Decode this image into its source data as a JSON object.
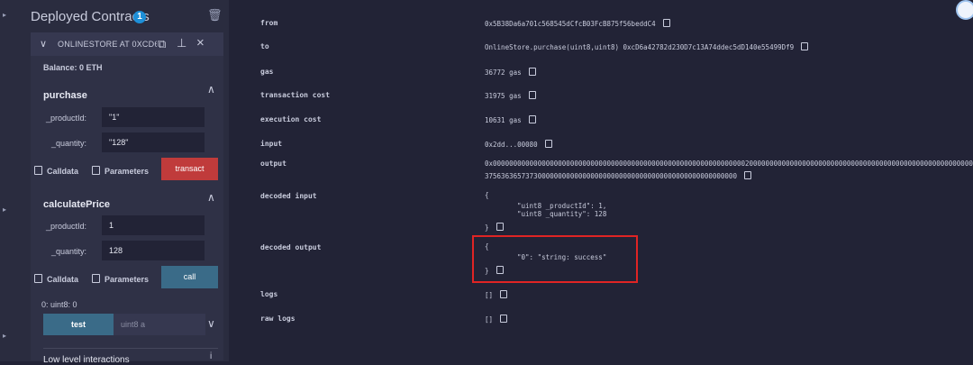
{
  "sidebar": {
    "title": "Deployed Contracts",
    "count": "1",
    "contract": {
      "name": "ONLINESTORE AT 0XCD6...99D",
      "balance": "Balance: 0 ETH",
      "functions": [
        {
          "name": "purchase",
          "params": [
            {
              "label": "_productId:",
              "value": "\"1\""
            },
            {
              "label": "_quantity:",
              "value": "\"128\""
            }
          ],
          "calldata": "Calldata",
          "parameters": "Parameters",
          "action": "transact"
        },
        {
          "name": "calculatePrice",
          "params": [
            {
              "label": "_productId:",
              "value": "1"
            },
            {
              "label": "_quantity:",
              "value": "128"
            }
          ],
          "calldata": "Calldata",
          "parameters": "Parameters",
          "action": "call",
          "result": "0: uint8: 0"
        }
      ],
      "test": {
        "label": "test",
        "placeholder": "uint8 a"
      }
    },
    "low_level": "Low level interactions"
  },
  "tx": {
    "from_label": "from",
    "from_value": "0x5B38Da6a701c568545dCfcB03FcB875f56beddC4",
    "to_label": "to",
    "to_value": "OnlineStore.purchase(uint8,uint8) 0xcD6a42782d230D7c13A74ddec5dD140e55499Df9",
    "gas_label": "gas",
    "gas_value": "36772 gas",
    "txcost_label": "transaction cost",
    "txcost_value": "31975 gas",
    "execcost_label": "execution cost",
    "execcost_value": "10631 gas",
    "input_label": "input",
    "input_value": "0x2dd...00080",
    "output_label": "output",
    "output_line1": "0x000000000000000000000000000000000000000000000000000000000000002000000000000000000000000000000000000000000000000000000000000000",
    "output_line2": "37563636573730000000000000000000000000000000000000000000000000",
    "decoded_input_label": "decoded input",
    "decoded_input_open": "{",
    "decoded_input_line1": "\"uint8 _productId\": 1,",
    "decoded_input_line2": "\"uint8 _quantity\": 128",
    "decoded_input_close": "}",
    "decoded_output_label": "decoded output",
    "decoded_output_open": "{",
    "decoded_output_line1": "\"0\": \"string: success\"",
    "decoded_output_close": "}",
    "logs_label": "logs",
    "logs_value": "[]",
    "rawlogs_label": "raw logs",
    "rawlogs_value": "[]"
  }
}
